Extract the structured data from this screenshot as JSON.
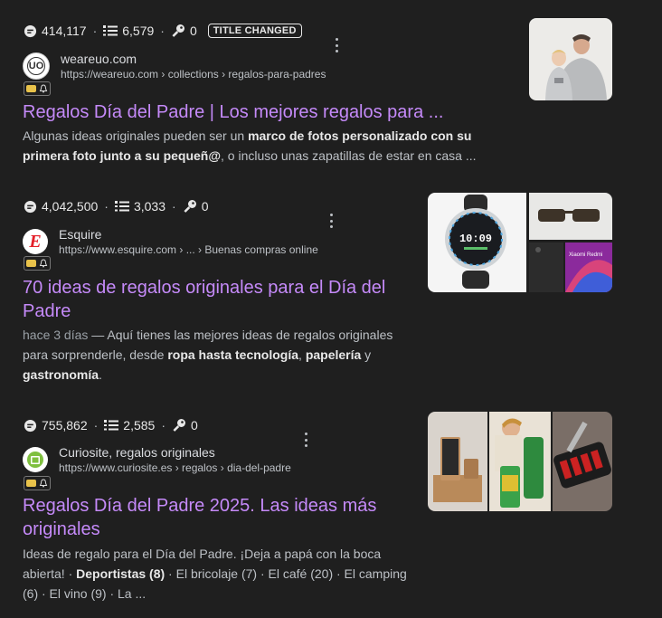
{
  "results": [
    {
      "metrics": {
        "views": "414,117",
        "lines": "6,579",
        "keys": "0",
        "badge": "TITLE CHANGED"
      },
      "site_name": "weareuo.com",
      "url": "https://weareuo.com › collections › regalos-para-padres",
      "favicon_text": "UO",
      "title": "Regalos Día del Padre | Los mejores regalos para ...",
      "snippet": {
        "part1": "Algunas ideas originales pueden ser un ",
        "bold1": "marco de fotos personalizado con su primera foto junto a su pequeñ@",
        "part2": ", o incluso unas zapatillas de estar en casa ..."
      }
    },
    {
      "metrics": {
        "views": "4,042,500",
        "lines": "3,033",
        "keys": "0"
      },
      "site_name": "Esquire",
      "url": "https://www.esquire.com › ... › Buenas compras online",
      "favicon_text": "E",
      "title_line1": "70 ideas de regalos originales para el Día del",
      "title_line2": "Padre",
      "snippet": {
        "date": "hace 3 días",
        "part1": " — Aquí tienes las mejores ideas de regalos originales para sorprenderle, desde ",
        "bold1": "ropa hasta tecnología",
        "part2": ", ",
        "bold2": "papelería",
        "part3": " y ",
        "bold3": "gastronomía",
        "part4": "."
      }
    },
    {
      "metrics": {
        "views": "755,862",
        "lines": "2,585",
        "keys": "0"
      },
      "site_name": "Curiosite, regalos originales",
      "url": "https://www.curiosite.es › regalos › dia-del-padre",
      "title_line1": "Regalos Día del Padre 2025. Las ideas más",
      "title_line2": "originales",
      "snippet": {
        "part1": "Ideas de regalo para el Día del Padre. ¡Deja a papá con la boca abierta! · ",
        "bold1": "Deportistas",
        "part2": " (8)",
        "part3": " · El bricolaje (7) · El café (20) · El camping (6) · El vino (9) · La ..."
      }
    }
  ],
  "watch_text": "10:09",
  "phone_text": "Xiaomi Redmi"
}
